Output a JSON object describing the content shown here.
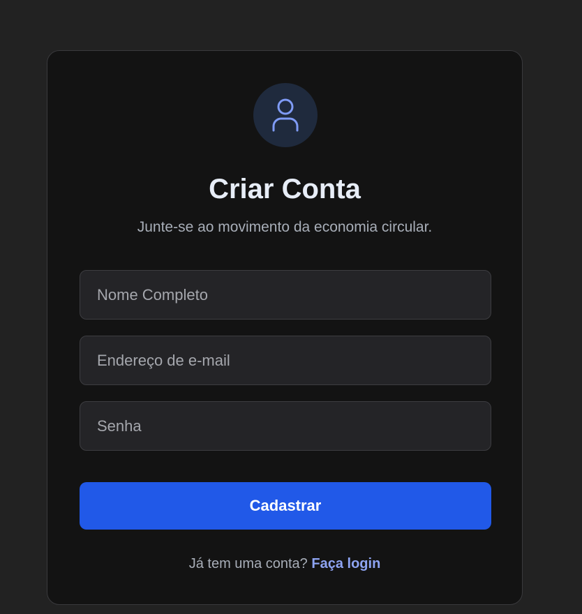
{
  "header": {
    "avatar_icon": "user-icon",
    "title": "Criar Conta",
    "subtitle": "Junte-se ao movimento da economia circular."
  },
  "form": {
    "name_placeholder": "Nome Completo",
    "email_placeholder": "Endereço de e-mail",
    "password_placeholder": "Senha",
    "submit_label": "Cadastrar"
  },
  "footer": {
    "prompt": "Já tem uma conta?",
    "login_link": "Faça login"
  },
  "colors": {
    "page_background": "#222222",
    "card_background": "#131313",
    "accent": "#2159e8",
    "link": "#8ea4f2",
    "icon": "#7f9bf5"
  }
}
